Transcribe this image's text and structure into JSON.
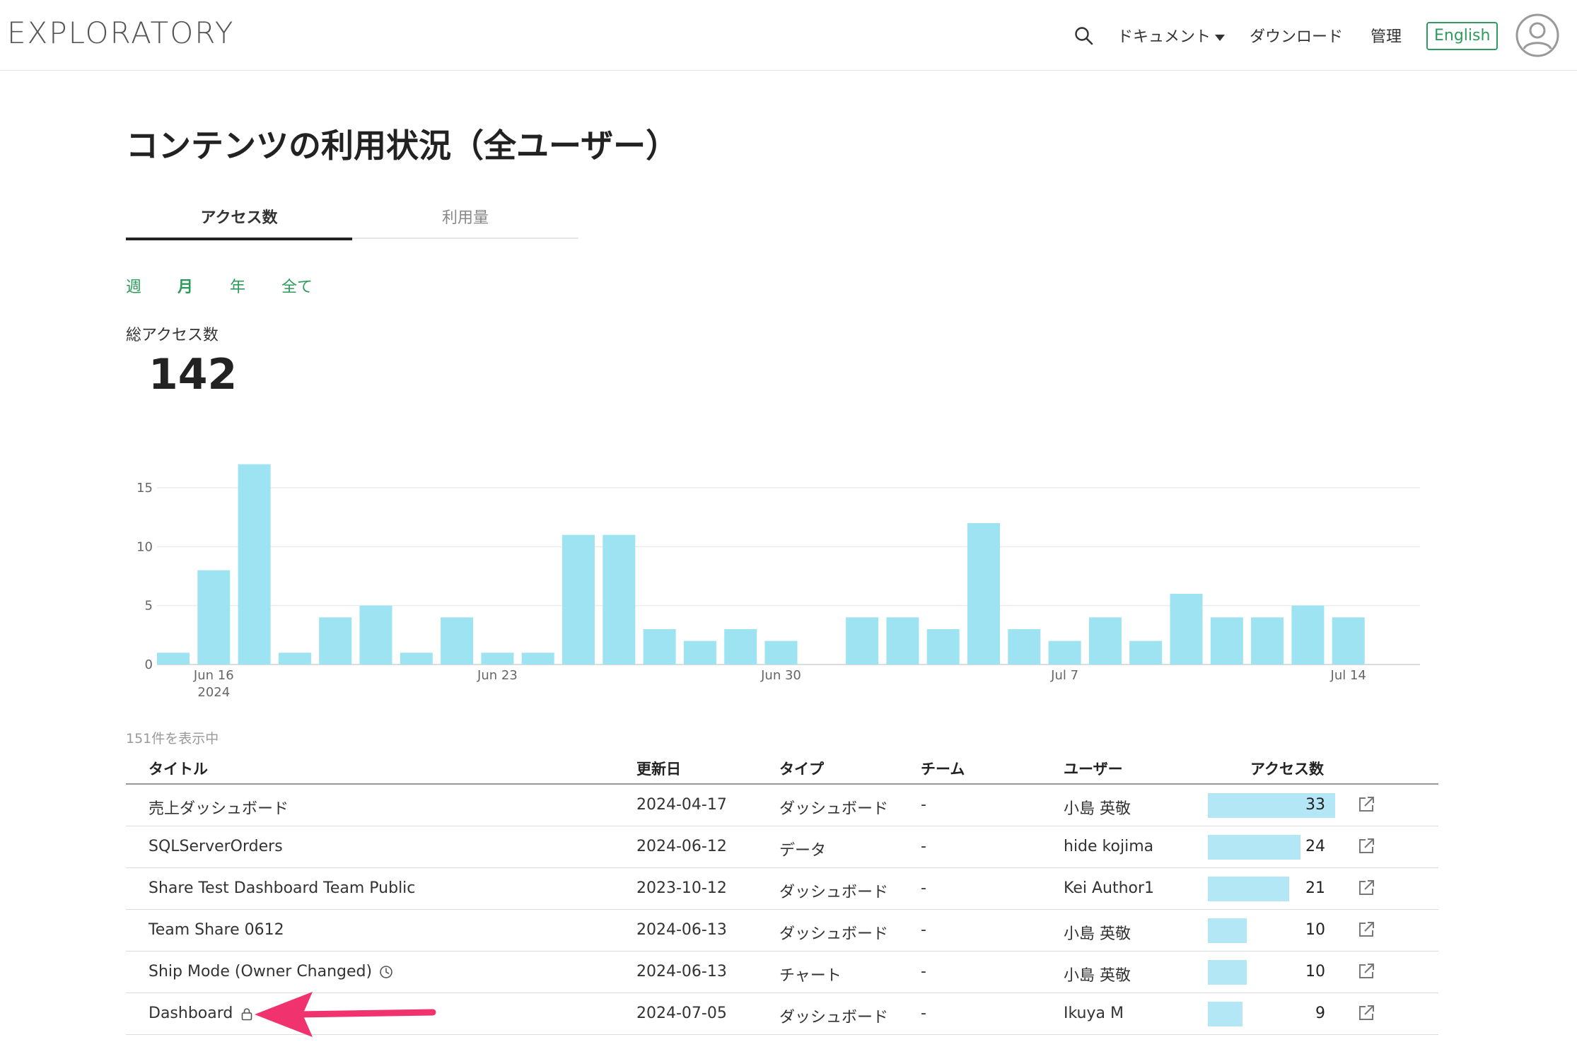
{
  "header": {
    "logo": "EXPLORATORY",
    "search_icon": "search-icon",
    "nav": {
      "docs": "ドキュメント",
      "download": "ダウンロード",
      "admin": "管理",
      "language": "English"
    },
    "avatar_icon": "user-avatar-icon"
  },
  "page": {
    "title": "コンテンツの利用状況（全ユーザー）",
    "tabs": [
      {
        "label": "アクセス数",
        "active": true
      },
      {
        "label": "利用量",
        "active": false
      }
    ],
    "periods": [
      {
        "label": "週",
        "active": false
      },
      {
        "label": "月",
        "active": true
      },
      {
        "label": "年",
        "active": false
      },
      {
        "label": "全て",
        "active": false
      }
    ],
    "total_label": "総アクセス数",
    "total_value": "142"
  },
  "chart_data": {
    "type": "bar",
    "bar_color": "#9de3f2",
    "x": [
      "2024-06-15",
      "2024-06-16",
      "2024-06-17",
      "2024-06-18",
      "2024-06-19",
      "2024-06-20",
      "2024-06-21",
      "2024-06-22",
      "2024-06-23",
      "2024-06-24",
      "2024-06-25",
      "2024-06-26",
      "2024-06-27",
      "2024-06-28",
      "2024-06-29",
      "2024-06-30",
      "2024-07-01",
      "2024-07-02",
      "2024-07-03",
      "2024-07-04",
      "2024-07-05",
      "2024-07-06",
      "2024-07-07",
      "2024-07-08",
      "2024-07-09",
      "2024-07-10",
      "2024-07-11",
      "2024-07-12",
      "2024-07-13",
      "2024-07-14",
      "2024-07-15"
    ],
    "values": [
      1,
      8,
      17,
      1,
      4,
      5,
      1,
      4,
      1,
      1,
      11,
      11,
      3,
      2,
      3,
      2,
      0,
      4,
      4,
      3,
      12,
      3,
      2,
      4,
      2,
      6,
      4,
      4,
      5,
      4
    ],
    "ylim": [
      0,
      18
    ],
    "yticks": [
      "0",
      "5",
      "10",
      "15"
    ],
    "xticks": [
      {
        "label": "Jun 16",
        "index": 1,
        "sub": "2024"
      },
      {
        "label": "Jun 23",
        "index": 8,
        "sub": ""
      },
      {
        "label": "Jun 30",
        "index": 15,
        "sub": ""
      },
      {
        "label": "Jul 7",
        "index": 22,
        "sub": ""
      },
      {
        "label": "Jul 14",
        "index": 29,
        "sub": ""
      }
    ],
    "grid": true
  },
  "table": {
    "count_label": "151件を表示中",
    "headers": {
      "title": "タイトル",
      "updated": "更新日",
      "type": "タイプ",
      "team": "チーム",
      "user": "ユーザー",
      "access": "アクセス数"
    },
    "max_access": 33,
    "rows": [
      {
        "title": "売上ダッシュボード",
        "updated": "2024-04-17",
        "type": "ダッシュボード",
        "team": "-",
        "user": "小島 英敬",
        "access": 33,
        "access_label": "33",
        "status_icon": ""
      },
      {
        "title": "SQLServerOrders",
        "updated": "2024-06-12",
        "type": "データ",
        "team": "-",
        "user": "hide kojima",
        "access": 24,
        "access_label": "24",
        "status_icon": ""
      },
      {
        "title": "Share Test Dashboard Team Public",
        "updated": "2023-10-12",
        "type": "ダッシュボード",
        "team": "-",
        "user": "Kei Author1",
        "access": 21,
        "access_label": "21",
        "status_icon": ""
      },
      {
        "title": "Team Share 0612",
        "updated": "2024-06-13",
        "type": "ダッシュボード",
        "team": "-",
        "user": "小島 英敬",
        "access": 10,
        "access_label": "10",
        "status_icon": ""
      },
      {
        "title": "Ship Mode (Owner Changed)",
        "updated": "2024-06-13",
        "type": "チャート",
        "team": "-",
        "user": "小島 英敬",
        "access": 10,
        "access_label": "10",
        "status_icon": "clock-icon"
      },
      {
        "title": "Dashboard",
        "updated": "2024-07-05",
        "type": "ダッシュボード",
        "team": "-",
        "user": "Ikuya M",
        "access": 9,
        "access_label": "9",
        "status_icon": "lock-icon"
      }
    ],
    "row_link_icon": "external-link-icon"
  },
  "annotation": {
    "arrow_color": "#f0326e",
    "arrow_icon": "pointer-arrow-icon"
  }
}
